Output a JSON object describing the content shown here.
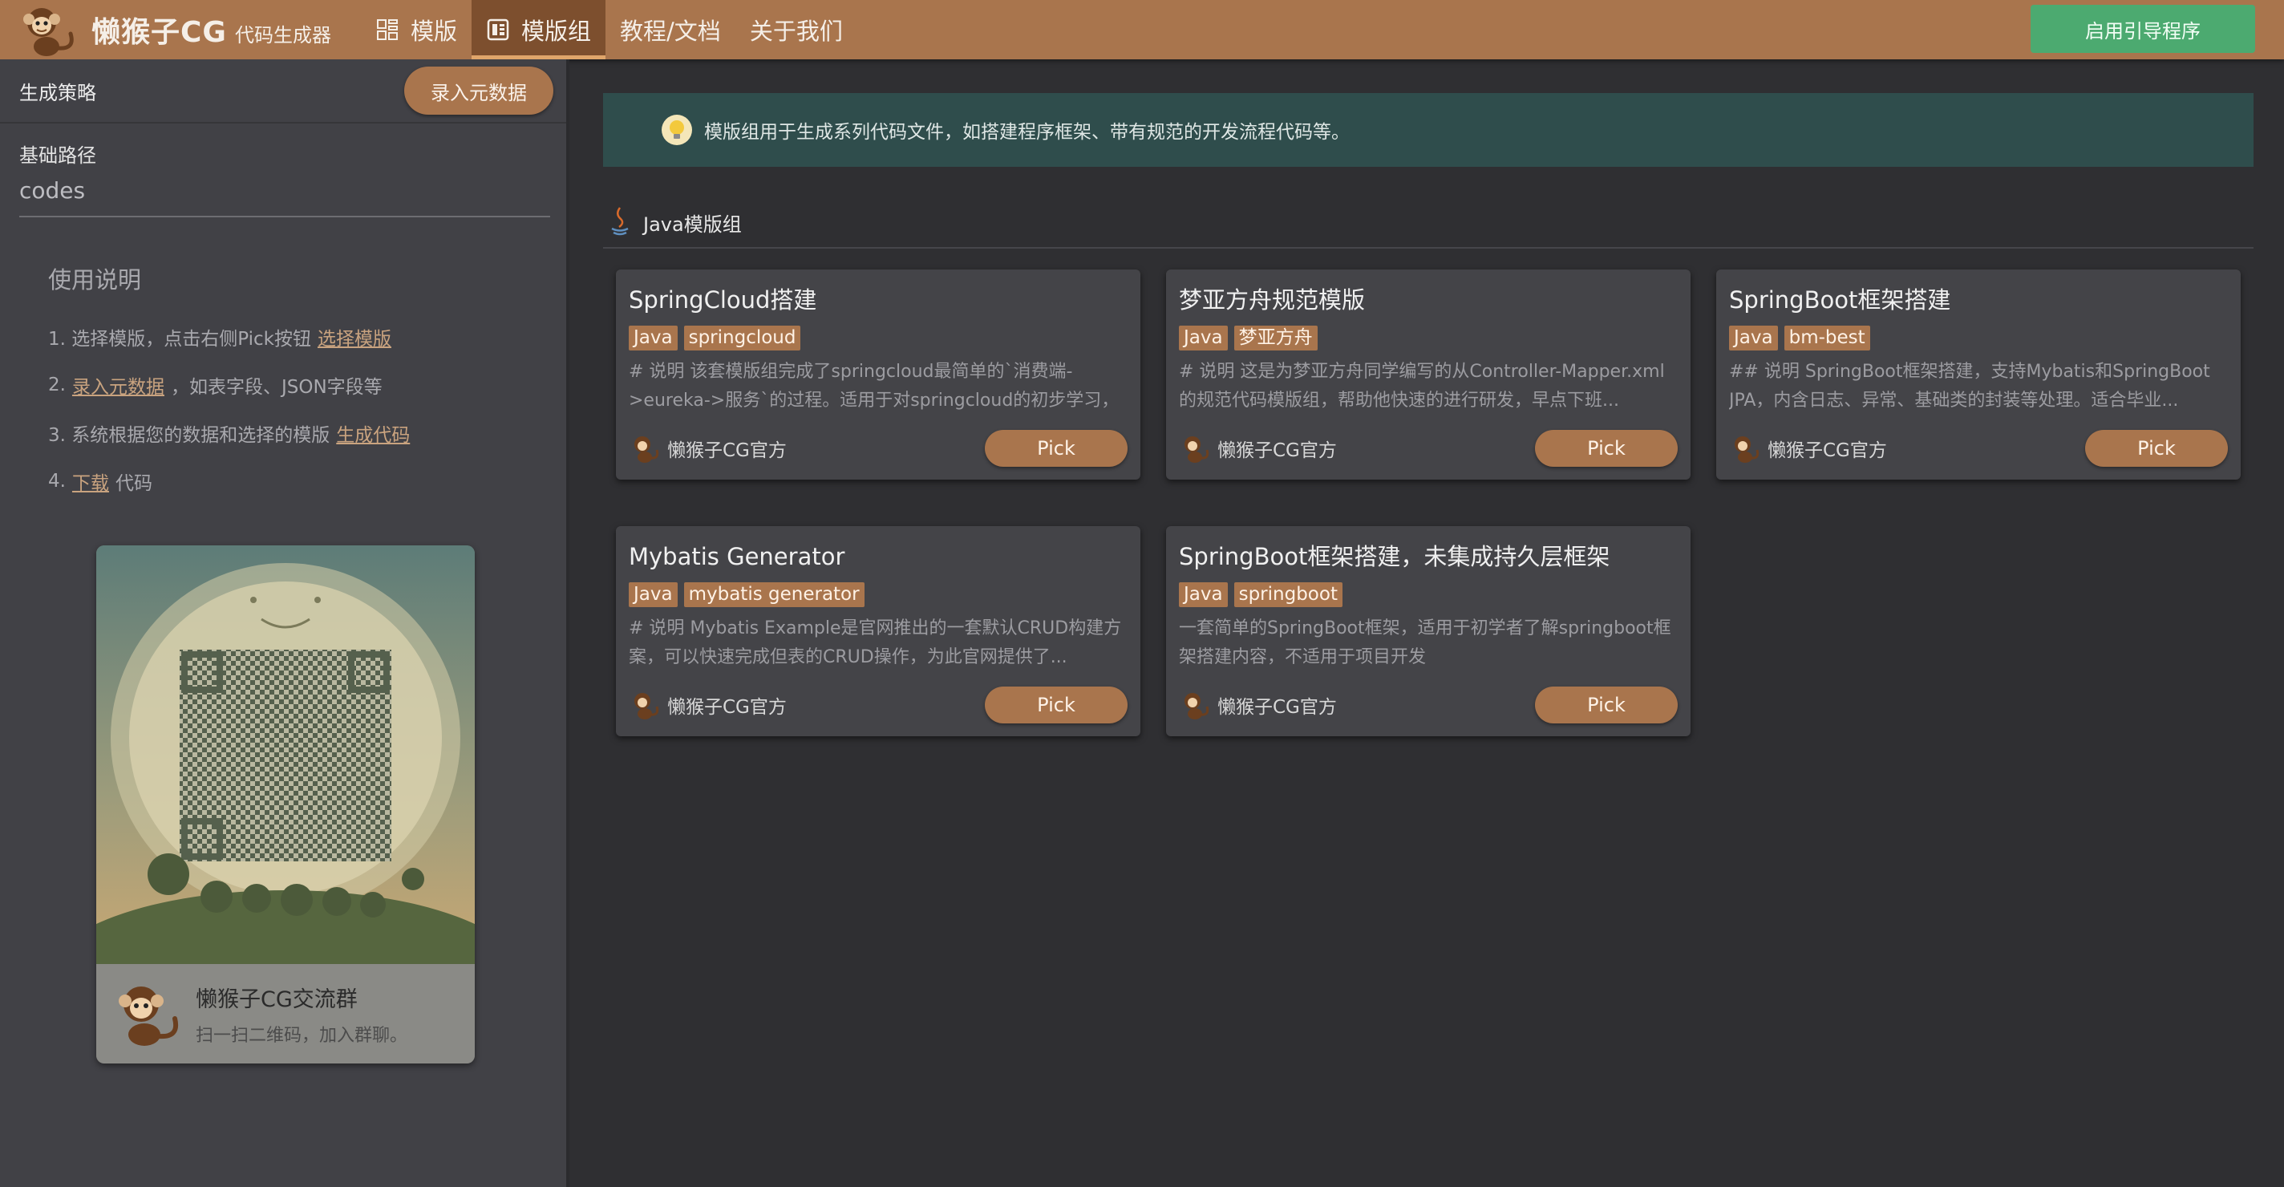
{
  "header": {
    "brand_name": "懒猴子CG",
    "brand_sub": "代码生成器",
    "nav": [
      {
        "label": "模版",
        "icon": "grid-icon"
      },
      {
        "label": "模版组",
        "icon": "template-group-icon",
        "active": true
      },
      {
        "label": "教程/文档"
      },
      {
        "label": "关于我们"
      }
    ],
    "guide_button": "启用引导程序",
    "colors": {
      "bar": "#a9754d",
      "active_tab": "#7d4f2e",
      "guide_button": "#4caa70"
    }
  },
  "sidebar": {
    "strategy_label": "生成策略",
    "meta_button": "录入元数据",
    "path_label": "基础路径",
    "path_value": "codes",
    "usage": {
      "title": "使用说明",
      "steps": [
        {
          "before": "1. 选择模版，点击右侧Pick按钮",
          "link": "选择模版",
          "after": ""
        },
        {
          "before": "2.",
          "link": "录入元数据",
          "after": "，如表字段、JSON字段等"
        },
        {
          "before": "3. 系统根据您的数据和选择的模版",
          "link": "生成代码",
          "after": ""
        },
        {
          "before": "4.",
          "link": "下载",
          "after": "代码"
        }
      ]
    },
    "qr_card": {
      "title": "懒猴子CG交流群",
      "subtitle": "扫一扫二维码，加入群聊。"
    }
  },
  "main": {
    "notice": "模版组用于生成系列代码文件，如搭建程序框架、带有规范的开发流程代码等。",
    "group_title": "Java模版组",
    "cards": [
      {
        "title": "SpringCloud搭建",
        "tags": [
          "Java",
          "springcloud"
        ],
        "desc": "# 说明 该套模版组完成了springcloud最简单的`消费端->eureka->服务`的过程。适用于对springcloud的初步学习，了...",
        "author": "懒猴子CG官方",
        "pick": "Pick"
      },
      {
        "title": "梦亚方舟规范模版",
        "tags": [
          "Java",
          "梦亚方舟"
        ],
        "desc": "# 说明 这是为梦亚方舟同学编写的从Controller-Mapper.xml的规范代码模版组，帮助他快速的进行研发，早点下班...",
        "author": "懒猴子CG官方",
        "pick": "Pick"
      },
      {
        "title": "SpringBoot框架搭建",
        "tags": [
          "Java",
          "bm-best"
        ],
        "desc": "## 说明 SpringBoot框架搭建，支持Mybatis和SpringBoot JPA，内含日志、异常、基础类的封装等处理。适合毕业...",
        "author": "懒猴子CG官方",
        "pick": "Pick"
      },
      {
        "title": "Mybatis Generator",
        "tags": [
          "Java",
          "mybatis generator"
        ],
        "desc": "# 说明 Mybatis Example是官网推出的一套默认CRUD构建方案，可以快速完成但表的CRUD操作，为此官网提供了...",
        "author": "懒猴子CG官方",
        "pick": "Pick"
      },
      {
        "title": "SpringBoot框架搭建，未集成持久层框架",
        "tags": [
          "Java",
          "springboot"
        ],
        "desc": "一套简单的SpringBoot框架，适用于初学者了解springboot框架搭建内容，不适用于项目开发",
        "author": "懒猴子CG官方",
        "pick": "Pick"
      }
    ]
  }
}
